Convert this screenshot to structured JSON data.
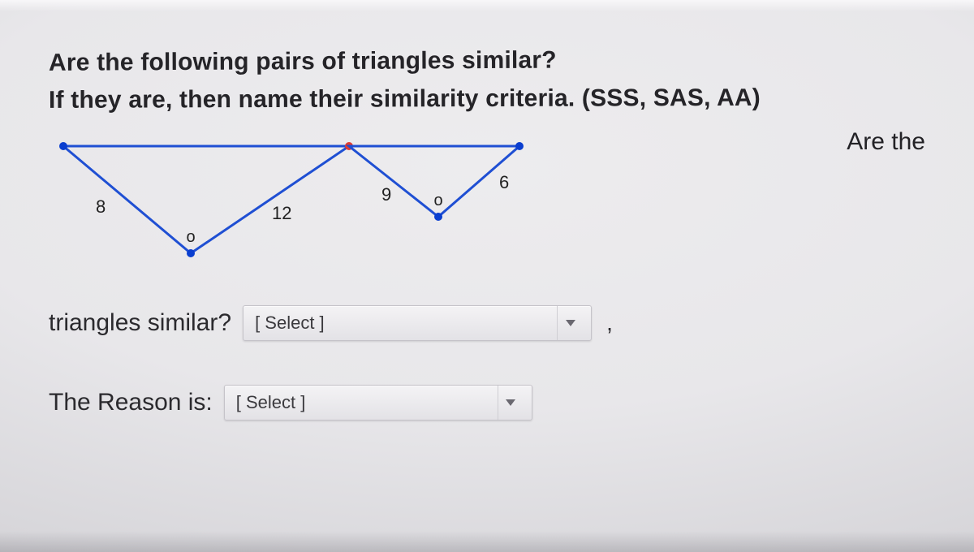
{
  "question": {
    "line1": "Are the following pairs of triangles similar?",
    "line2": "If they are, then name their similarity criteria.  (SSS, SAS, AA)",
    "wrap_fragment": "Are the"
  },
  "figure": {
    "triangle1": {
      "side_left": "8",
      "side_right": "12",
      "angle_marker": "o"
    },
    "triangle2": {
      "side_left": "9",
      "side_right": "6",
      "angle_marker": "o"
    }
  },
  "prompts": {
    "similar_label": "triangles similar?",
    "reason_label": "The Reason is:"
  },
  "selects": {
    "placeholder": "[ Select ]",
    "comma": ","
  }
}
